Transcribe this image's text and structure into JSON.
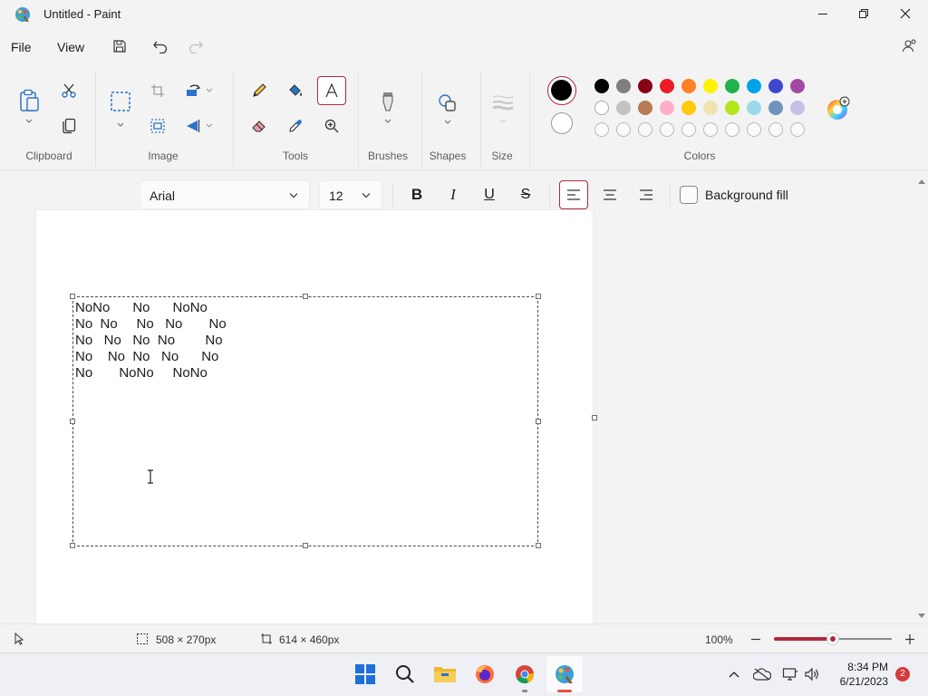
{
  "titlebar": {
    "title": "Untitled - Paint"
  },
  "menu": {
    "file_label": "File",
    "view_label": "View"
  },
  "ribbon": {
    "groups": {
      "clipboard": "Clipboard",
      "image": "Image",
      "tools": "Tools",
      "brushes": "Brushes",
      "shapes": "Shapes",
      "size": "Size",
      "colors": "Colors"
    },
    "palette_row1": [
      "#000000",
      "#7f7f7f",
      "#880015",
      "#ed1c24",
      "#ff7f27",
      "#fff200",
      "#22b14c",
      "#00a2e8",
      "#3f48cc",
      "#a349a4"
    ],
    "palette_row2": [
      "#ffffff",
      "#c3c3c3",
      "#b97a57",
      "#ffaec9",
      "#ffc90e",
      "#efe4b0",
      "#b5e61d",
      "#99d9ea",
      "#7092be",
      "#c8bfe7"
    ],
    "primary_color": "#000000",
    "secondary_color": "#ffffff"
  },
  "text_toolbar": {
    "font": "Arial",
    "size": "12",
    "background_fill_label": "Background fill",
    "background_fill_checked": false,
    "alignment": "left"
  },
  "canvas": {
    "text_lines": [
      "NoNo      No      NoNo",
      "No  No     No   No       No",
      "No   No   No  No        No",
      "No    No  No   No      No",
      "No       NoNo     NoNo"
    ]
  },
  "statusbar": {
    "selection_size": "508 × 270px",
    "canvas_size": "614 × 460px",
    "zoom": "100%",
    "zoom_slider_value": 0.5
  },
  "taskbar": {
    "time": "8:34 PM",
    "date": "6/21/2023",
    "notification_count": "2"
  }
}
